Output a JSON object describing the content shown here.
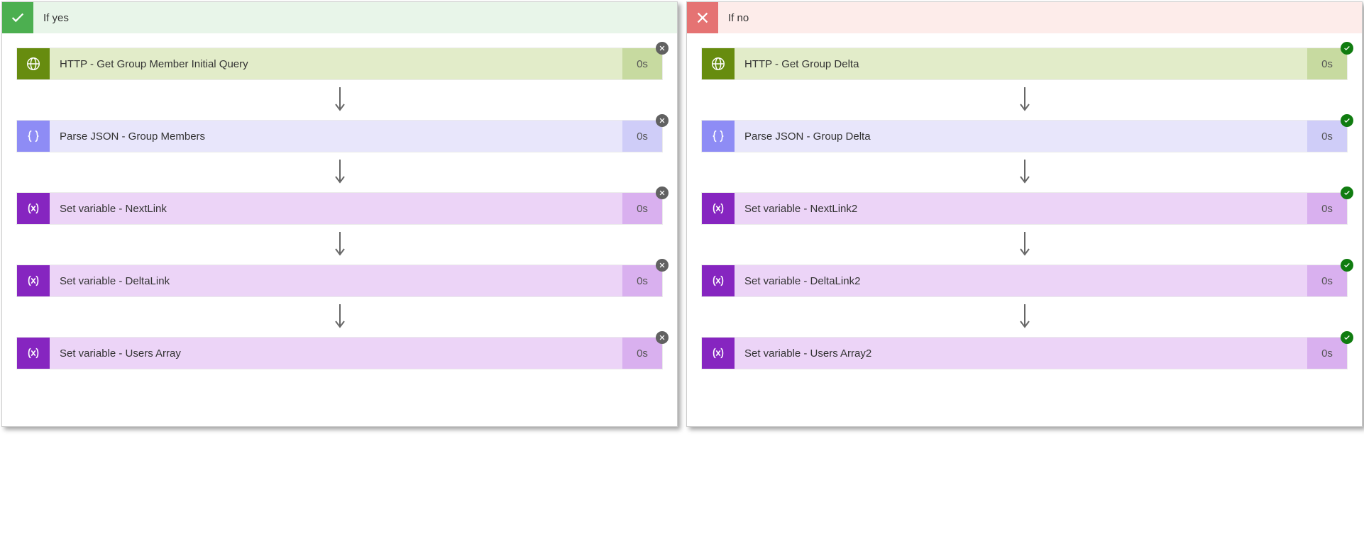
{
  "yes": {
    "title": "If yes",
    "actions": [
      {
        "type": "http",
        "label": "HTTP - Get Group Member Initial Query",
        "duration": "0s",
        "status": "error"
      },
      {
        "type": "parse",
        "label": "Parse JSON - Group Members",
        "duration": "0s",
        "status": "error"
      },
      {
        "type": "var",
        "label": "Set variable - NextLink",
        "duration": "0s",
        "status": "error"
      },
      {
        "type": "var",
        "label": "Set variable - DeltaLink",
        "duration": "0s",
        "status": "error"
      },
      {
        "type": "var",
        "label": "Set variable - Users Array",
        "duration": "0s",
        "status": "error"
      }
    ]
  },
  "no": {
    "title": "If no",
    "actions": [
      {
        "type": "http",
        "label": "HTTP - Get Group Delta",
        "duration": "0s",
        "status": "ok"
      },
      {
        "type": "parse",
        "label": "Parse JSON - Group Delta",
        "duration": "0s",
        "status": "ok"
      },
      {
        "type": "var",
        "label": "Set variable - NextLink2",
        "duration": "0s",
        "status": "ok"
      },
      {
        "type": "var",
        "label": "Set variable - DeltaLink2",
        "duration": "0s",
        "status": "ok"
      },
      {
        "type": "var",
        "label": "Set variable - Users Array2",
        "duration": "0s",
        "status": "ok"
      }
    ]
  }
}
